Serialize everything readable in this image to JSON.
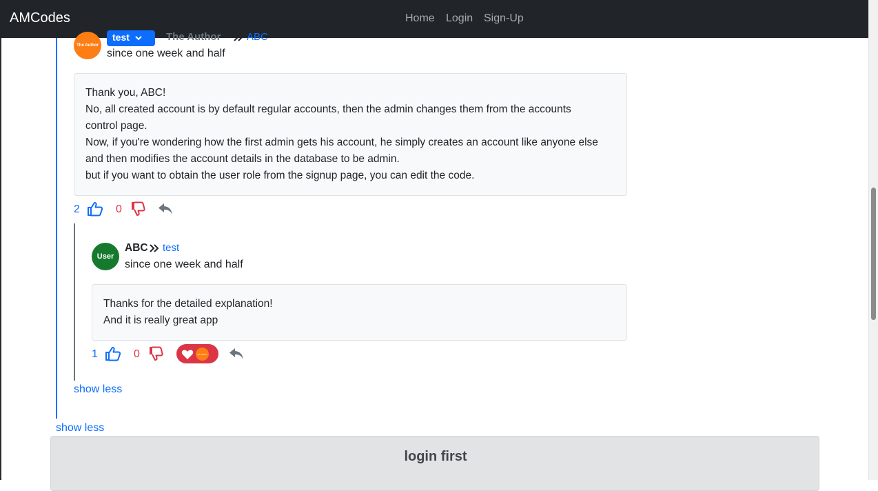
{
  "navbar": {
    "brand": "AMCodes",
    "links": [
      "Home",
      "Login",
      "Sign-Up"
    ]
  },
  "comment": {
    "avatar_label": "The Author",
    "user_dropdown": "test",
    "role": "The Author",
    "reply_to": "ABC",
    "time": "since one week and half",
    "body_lines": [
      "Thank you, ABC!",
      "No, all created account is by default regular accounts, then the admin changes them from the accounts",
      "control page.",
      "Now, if you're wondering how the first admin gets his account, he simply creates an account like anyone else",
      "and then modifies the account details in the database to be admin.",
      "but if you want to obtain the user role from the signup page, you can edit the code."
    ],
    "likes": "2",
    "dislikes": "0"
  },
  "reply": {
    "avatar_label": "User",
    "author": "ABC",
    "reply_to": "test",
    "time": "since one week and half",
    "body_lines": [
      "Thanks for the detailed explanation!",
      "And it is really great app"
    ],
    "likes": "1",
    "dislikes": "0",
    "reaction": "heart",
    "reaction_avatar_label": "The Author"
  },
  "show_less_inner": "show less",
  "show_less_outer": "show less",
  "login_notice": "login first",
  "colors": {
    "primary": "#0d6efd",
    "danger": "#dc3545",
    "author_avatar": "#fd7e14",
    "user_avatar": "#157a2e",
    "navbar": "#212529"
  },
  "icons": [
    "thumbs-up-icon",
    "thumbs-down-icon",
    "reply-icon",
    "heart-icon",
    "double-chevron-right-icon",
    "chevron-down-icon"
  ]
}
